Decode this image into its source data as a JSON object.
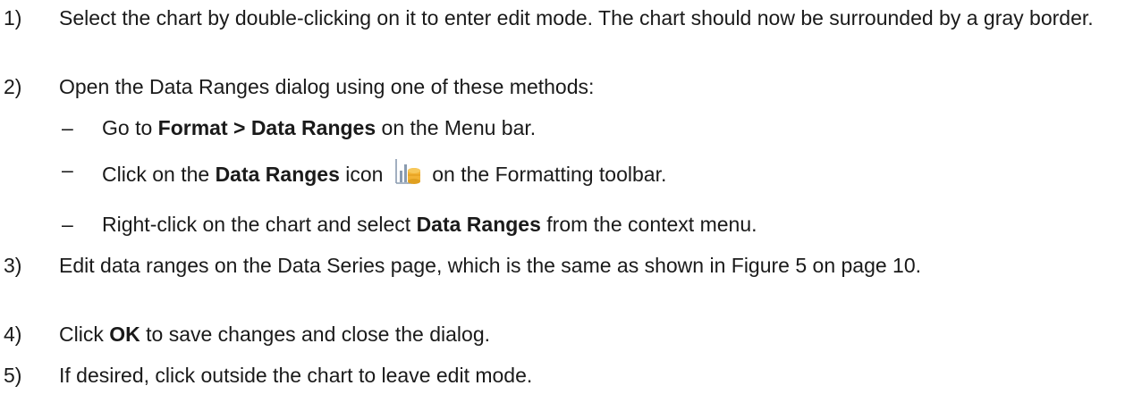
{
  "steps": [
    {
      "num": "1)",
      "text": "Select the chart by double-clicking on it to enter edit mode. The chart should now be surrounded by a gray border."
    },
    {
      "num": "2)",
      "text": "Open the Data Ranges dialog using one of these methods:"
    },
    {
      "num": "3)",
      "text": "Edit data ranges on the Data Series page, which is the same as shown in Figure 5 on page 10."
    },
    {
      "num": "4)",
      "pre": "Click ",
      "bold": "OK",
      "post": " to save changes and close the dialog."
    },
    {
      "num": "5)",
      "text": "If desired, click outside the chart to leave edit mode."
    }
  ],
  "methods": [
    {
      "dash": "–",
      "pre": "Go to ",
      "bold": "Format > Data Ranges",
      "post": " on the Menu bar."
    },
    {
      "dash": "–",
      "pre": "Click on the ",
      "bold": "Data Ranges",
      "mid": " icon",
      "post": " on the Formatting toolbar.",
      "icon": "data-ranges-icon"
    },
    {
      "dash": "–",
      "pre": "Right-click on the chart and select ",
      "bold": "Data Ranges",
      "post": " from the context menu."
    }
  ],
  "colors": {
    "text": "#1a1a1a",
    "icon_bar": "#8a9bb0",
    "icon_db": "#f2b233"
  }
}
